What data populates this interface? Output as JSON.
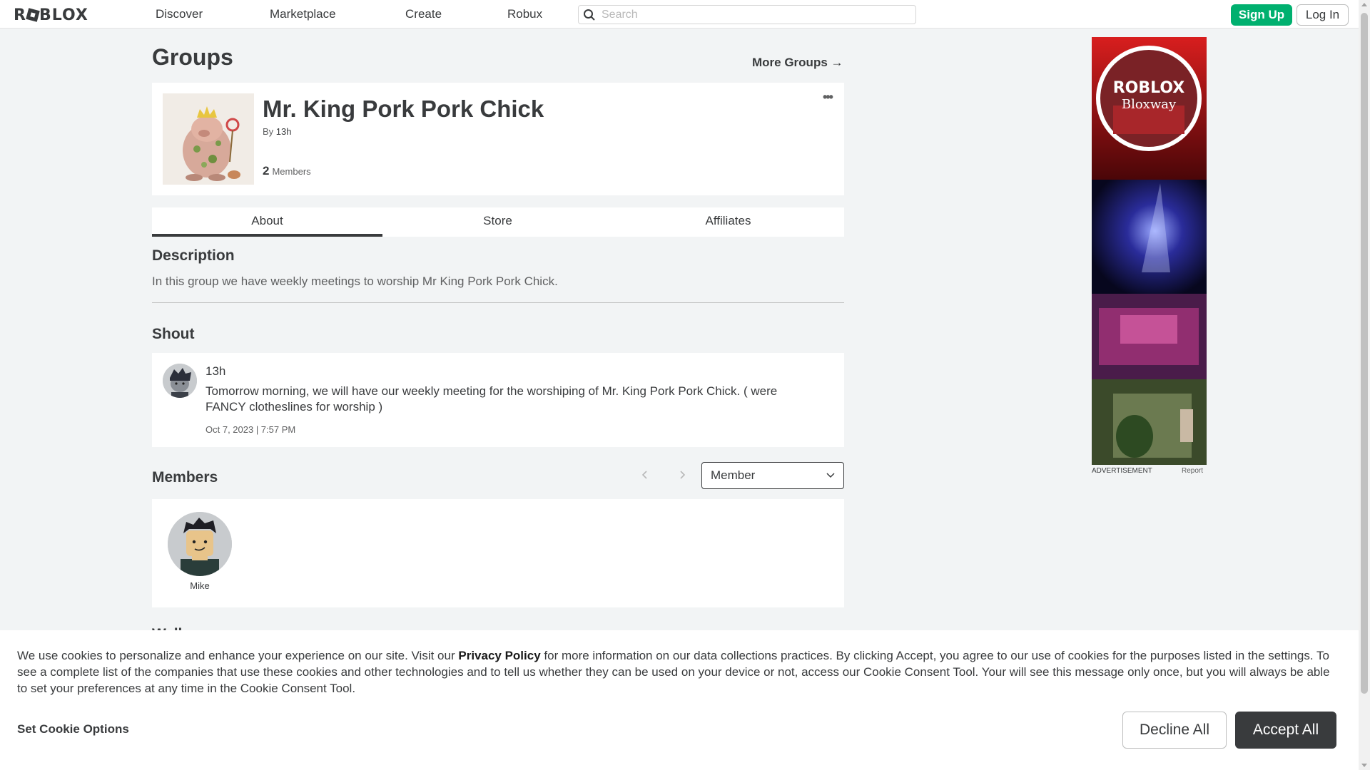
{
  "nav": {
    "logo": "ROBLOX",
    "links": [
      "Discover",
      "Marketplace",
      "Create",
      "Robux"
    ],
    "search_placeholder": "Search",
    "signup_label": "Sign Up",
    "login_label": "Log In",
    "signup_color": "#00b06f"
  },
  "page": {
    "title": "Groups",
    "more_groups": "More Groups →"
  },
  "group": {
    "name": "Mr. King Pork Pork Chick",
    "by_prefix": "By",
    "owner": "13h",
    "member_count": "2",
    "members_label": "Members",
    "more_icon": "ellipsis-icon"
  },
  "tabs": [
    "About",
    "Store",
    "Affiliates"
  ],
  "active_tab": "About",
  "description": {
    "title": "Description",
    "text": "In this group we have weekly meetings to worship Mr King Pork Pork Chick."
  },
  "shout": {
    "title": "Shout",
    "user": "13h",
    "text": "Tomorrow morning, we will have our weekly meeting for the worshiping of Mr. King Pork Pork Chick. ( were FANCY clotheslines for worship )",
    "date": "Oct 7, 2023 | 7:57 PM"
  },
  "members": {
    "title": "Members",
    "role_filter": "Member",
    "list": [
      {
        "name": "Mike"
      }
    ]
  },
  "cutoff_section": "Wall",
  "ad": {
    "label": "ADVERTISEMENT",
    "report": "Report",
    "brand": "ROBLOX",
    "sub": "Bloxway"
  },
  "cookie": {
    "text_before": "We use cookies to personalize and enhance your experience on our site. Visit our ",
    "link": "Privacy Policy",
    "text_after": " for more information on our data collections practices. By clicking Accept, you agree to our use of cookies for the purposes listed in the settings. To see a complete list of the companies that use these cookies and other technologies and to tell us whether they can be used on your device or not, access our Cookie Consent Tool. Your will see this message only once, but you will always be able to set your preferences at any time in the Cookie Consent Tool.",
    "options_label": "Set Cookie Options",
    "decline_label": "Decline All",
    "accept_label": "Accept All"
  }
}
